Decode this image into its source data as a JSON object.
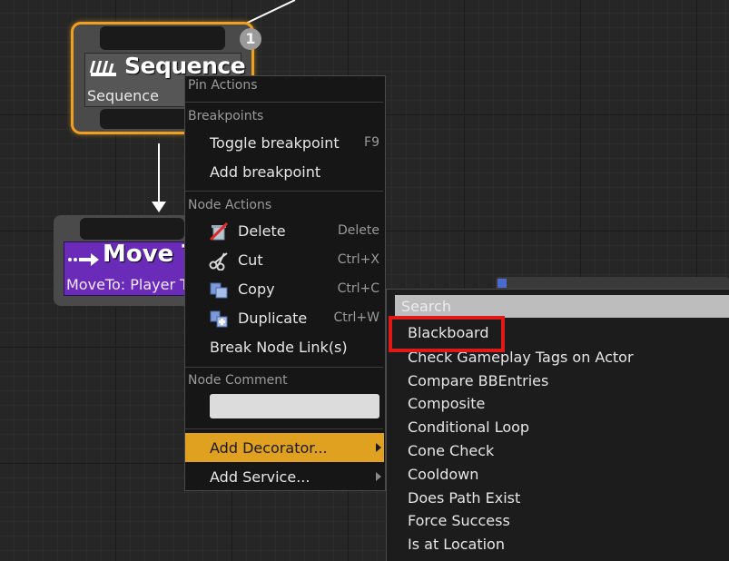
{
  "graph": {
    "sequence_node": {
      "title": "Sequence",
      "subtitle": "Sequence",
      "badge": "1"
    },
    "move_node": {
      "title": "Move To",
      "subtitle": "MoveTo: Player Target"
    }
  },
  "context_menu": {
    "pin_actions_header": "Pin Actions",
    "breakpoints_header": "Breakpoints",
    "toggle_breakpoint": {
      "label": "Toggle breakpoint",
      "shortcut": "F9"
    },
    "add_breakpoint": {
      "label": "Add breakpoint"
    },
    "node_actions_header": "Node Actions",
    "delete": {
      "label": "Delete",
      "shortcut": "Delete",
      "icon": "delete-icon"
    },
    "cut": {
      "label": "Cut",
      "shortcut": "Ctrl+X",
      "icon": "scissors-icon"
    },
    "copy": {
      "label": "Copy",
      "shortcut": "Ctrl+C",
      "icon": "copy-icon"
    },
    "duplicate": {
      "label": "Duplicate",
      "shortcut": "Ctrl+W",
      "icon": "duplicate-icon"
    },
    "break_links": {
      "label": "Break Node Link(s)"
    },
    "node_comment_header": "Node Comment",
    "node_comment_value": "",
    "add_decorator": {
      "label": "Add Decorator..."
    },
    "add_service": {
      "label": "Add Service..."
    },
    "highlight_color": "#e0a020"
  },
  "decorator_submenu": {
    "search_placeholder": "Search",
    "items": [
      "Blackboard",
      "Check Gameplay Tags on Actor",
      "Compare BBEntries",
      "Composite",
      "Conditional Loop",
      "Cone Check",
      "Cooldown",
      "Does Path Exist",
      "Force Success",
      "Is at Location"
    ],
    "annotation_color": "#e01818"
  }
}
